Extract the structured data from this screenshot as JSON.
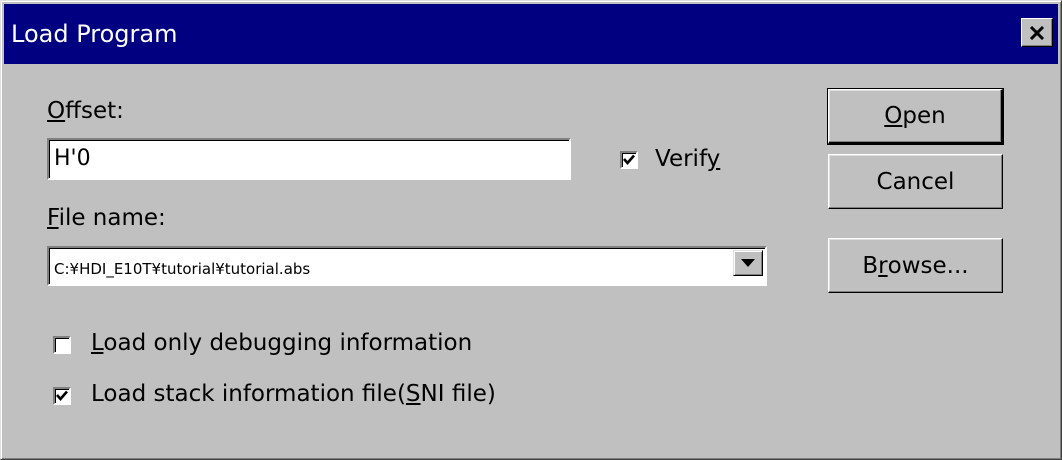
{
  "window": {
    "title": "Load Program"
  },
  "offset": {
    "label_pre": "",
    "label_mnemonic": "O",
    "label_post": "ffset:",
    "value": "H'0"
  },
  "verify": {
    "label_pre": "Verif",
    "label_mnemonic": "y",
    "label_post": "",
    "checked": true
  },
  "file_name": {
    "label_pre": "",
    "label_mnemonic": "F",
    "label_post": "ile name:",
    "value": "C:¥HDI_E10T¥tutorial¥tutorial.abs"
  },
  "options": [
    {
      "pre": "",
      "mnemonic": "L",
      "post": "oad only debugging information",
      "checked": false
    },
    {
      "pre": "Load stack information file(",
      "mnemonic": "S",
      "post": "NI file)",
      "checked": true
    }
  ],
  "buttons": {
    "open": {
      "pre": "",
      "mnemonic": "O",
      "post": "pen"
    },
    "cancel": {
      "pre": "Cancel",
      "mnemonic": "",
      "post": ""
    },
    "browse": {
      "pre": "B",
      "mnemonic": "r",
      "post": "owse..."
    }
  },
  "icons": {
    "close": "close-icon",
    "dropdown": "chevron-down-icon",
    "check": "checkmark-icon"
  },
  "colors": {
    "titlebar": "#000080",
    "face": "#c0c0c0"
  }
}
